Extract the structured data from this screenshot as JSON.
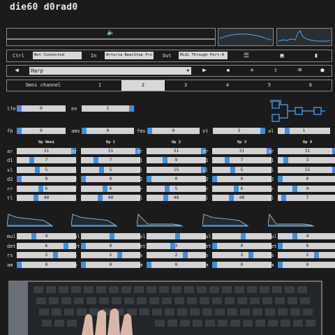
{
  "title": "die60 d0rad0",
  "io_bar": {
    "ctrl_label": "Ctrl",
    "ctrl_value": "Not Connected",
    "in_label": "In",
    "in_value": "Arturia BeatStep Pro",
    "out_label": "Out",
    "out_value": "Midi Through Port-0"
  },
  "patch": {
    "name": "Harp"
  },
  "channel_tabs": {
    "items": [
      "Omni channel",
      "1",
      "2",
      "3",
      "4",
      "5",
      "6"
    ],
    "active_index": 2
  },
  "global": {
    "lfo": {
      "label": "lfo",
      "value": "0",
      "level": 0.0
    },
    "en": {
      "label": "en",
      "value": "1",
      "level": 1.0
    },
    "fb": {
      "label": "fb",
      "value": "0",
      "level": 0.0
    },
    "ams": {
      "label": "ams",
      "value": "0",
      "level": 0.0
    },
    "fms": {
      "label": "fms",
      "value": "0",
      "level": 0.0
    },
    "st": {
      "label": "st",
      "value": "3",
      "level": 1.0
    },
    "al": {
      "label": "al",
      "value": "1",
      "level": 0.14
    }
  },
  "op_headers": [
    "Op Omni",
    "Op 1",
    "Op 2",
    "Op 3",
    "Op 4"
  ],
  "op_params_top": [
    {
      "label": "ar",
      "values": [
        "31",
        "31",
        "31",
        "31",
        "31"
      ],
      "levels": [
        1,
        1,
        1,
        1,
        1
      ]
    },
    {
      "label": "d1",
      "values": [
        "7",
        "7",
        "9",
        "7",
        "3"
      ],
      "levels": [
        0.23,
        0.23,
        0.29,
        0.23,
        0.1
      ]
    },
    {
      "label": "sl",
      "values": [
        "5",
        "5",
        "15",
        "5",
        "15"
      ],
      "levels": [
        0.33,
        0.33,
        1,
        0.33,
        1
      ]
    },
    {
      "label": "d2",
      "values": [
        "0",
        "0",
        "0",
        "0",
        "0"
      ],
      "levels": [
        0,
        0,
        0,
        0,
        0
      ]
    },
    {
      "label": "rr",
      "values": [
        "6",
        "6",
        "5",
        "6",
        "4"
      ],
      "levels": [
        0.4,
        0.4,
        0.33,
        0.4,
        0.27
      ]
    },
    {
      "label": "tl",
      "values": [
        "40",
        "40",
        "40",
        "40",
        "7"
      ],
      "levels": [
        0.31,
        0.31,
        0.31,
        0.31,
        0.06
      ]
    }
  ],
  "op_params_bottom": [
    {
      "label": "mul",
      "values": [
        "4",
        "8",
        "8",
        "8",
        "4"
      ],
      "levels": [
        0.27,
        0.53,
        0.53,
        0.53,
        0.27
      ]
    },
    {
      "label": "det",
      "values": [
        "6",
        "0",
        "3",
        "0",
        "0"
      ],
      "levels": [
        0.86,
        0,
        0.43,
        0,
        0
      ]
    },
    {
      "label": "rs",
      "values": [
        "2",
        "2",
        "2",
        "2",
        "2"
      ],
      "levels": [
        0.67,
        0.67,
        0.67,
        0.67,
        0.67
      ]
    },
    {
      "label": "am",
      "values": [
        "0",
        "0",
        "0",
        "0",
        "0"
      ],
      "levels": [
        0,
        0,
        0,
        0,
        0
      ]
    }
  ],
  "colors": {
    "accent": "#3d8fe0",
    "background": "#1b1b1b",
    "field": "#d2d2d2"
  },
  "icons": {
    "volume": "speaker-icon",
    "toolbar": [
      "prev-icon",
      "next-icon",
      "save-icon",
      "add-icon",
      "upload-icon",
      "erase-icon",
      "record-icon"
    ],
    "io_tools": [
      "sliders-icon",
      "clipboard-icon",
      "trash-icon"
    ]
  }
}
